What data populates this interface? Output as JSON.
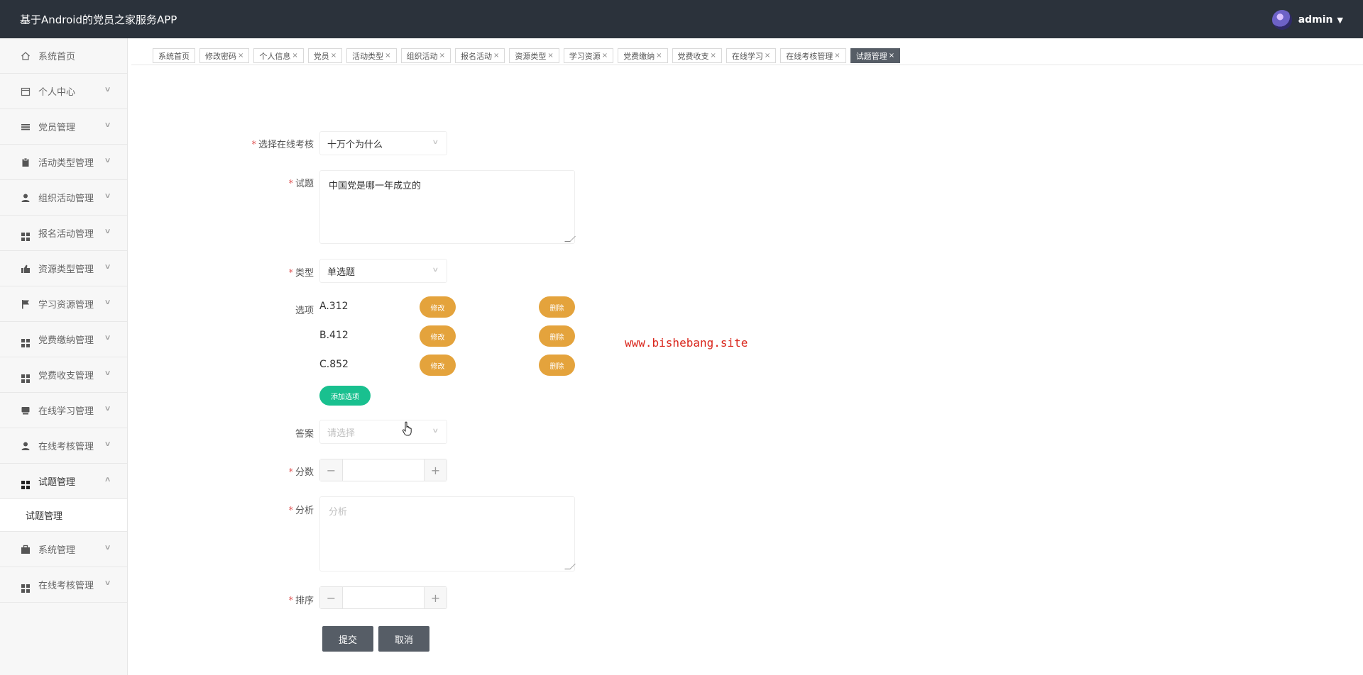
{
  "header": {
    "app_title": "基于Android的党员之家服务APP",
    "user_name": "admin",
    "caret": "▼"
  },
  "sidebar": {
    "items": [
      {
        "label": "系统首页",
        "icon": "home-icon",
        "arrow": ""
      },
      {
        "label": "个人中心",
        "icon": "calendar-icon",
        "arrow": "∨"
      },
      {
        "label": "党员管理",
        "icon": "list-icon",
        "arrow": "∨"
      },
      {
        "label": "活动类型管理",
        "icon": "clipboard-icon",
        "arrow": "∨"
      },
      {
        "label": "组织活动管理",
        "icon": "user-icon",
        "arrow": "∨"
      },
      {
        "label": "报名活动管理",
        "icon": "grid-icon",
        "arrow": "∨"
      },
      {
        "label": "资源类型管理",
        "icon": "thumb-icon",
        "arrow": "∨"
      },
      {
        "label": "学习资源管理",
        "icon": "flag-icon",
        "arrow": "∨"
      },
      {
        "label": "党费缴纳管理",
        "icon": "grid-icon",
        "arrow": "∨"
      },
      {
        "label": "党费收支管理",
        "icon": "grid-icon",
        "arrow": "∨"
      },
      {
        "label": "在线学习管理",
        "icon": "monitor-icon",
        "arrow": "∨"
      },
      {
        "label": "在线考核管理",
        "icon": "user-icon",
        "arrow": "∨"
      },
      {
        "label": "试题管理",
        "icon": "grid-icon",
        "arrow": "∧"
      },
      {
        "label": "系统管理",
        "icon": "briefcase-icon",
        "arrow": "∨"
      },
      {
        "label": "在线考核管理",
        "icon": "grid-icon",
        "arrow": "∨"
      }
    ],
    "sub_item": "试题管理"
  },
  "tabs": [
    {
      "label": "系统首页",
      "close": ""
    },
    {
      "label": "修改密码",
      "close": "×"
    },
    {
      "label": "个人信息",
      "close": "×"
    },
    {
      "label": "党员",
      "close": "×"
    },
    {
      "label": "活动类型",
      "close": "×"
    },
    {
      "label": "组织活动",
      "close": "×"
    },
    {
      "label": "报名活动",
      "close": "×"
    },
    {
      "label": "资源类型",
      "close": "×"
    },
    {
      "label": "学习资源",
      "close": "×"
    },
    {
      "label": "党费缴纳",
      "close": "×"
    },
    {
      "label": "党费收支",
      "close": "×"
    },
    {
      "label": "在线学习",
      "close": "×"
    },
    {
      "label": "在线考核管理",
      "close": "×"
    },
    {
      "label": "试题管理",
      "close": "×"
    }
  ],
  "form": {
    "required_mark": "*",
    "exam_label": "选择在线考核",
    "exam_value": "十万个为什么",
    "question_label": "试题",
    "question_value": "中国党是哪一年成立的",
    "type_label": "类型",
    "type_value": "单选题",
    "options_label": "选项",
    "options": [
      {
        "text": "A.312",
        "edit": "修改",
        "delete": "删除"
      },
      {
        "text": "B.412",
        "edit": "修改",
        "delete": "删除"
      },
      {
        "text": "C.852",
        "edit": "修改",
        "delete": "删除"
      }
    ],
    "add_option": "添加选项",
    "answer_label": "答案",
    "answer_placeholder": "请选择",
    "score_label": "分数",
    "analysis_label": "分析",
    "analysis_placeholder": "分析",
    "sort_label": "排序",
    "minus": "−",
    "plus": "+",
    "submit": "提交",
    "cancel": "取消",
    "chevron": "∨"
  },
  "watermark": "www.bishebang.site"
}
